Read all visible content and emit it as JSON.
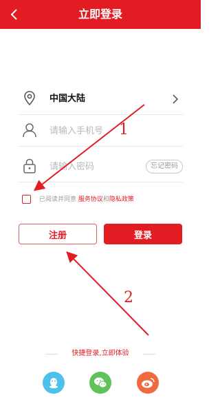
{
  "header": {
    "title": "立即登录",
    "back_icon": "chevron-left-icon",
    "color": "#e31b23"
  },
  "region": {
    "label": "中国大陆",
    "icon": "location-pin-icon"
  },
  "phone": {
    "placeholder": "请输入手机号",
    "value": "",
    "icon": "user-icon"
  },
  "password": {
    "placeholder": "请输入密码",
    "value": "",
    "icon": "lock-icon",
    "forgot_label": "忘记密码"
  },
  "agreement": {
    "checked": false,
    "prefix": "已阅读并同意 ",
    "service_link": "服务协议",
    "middle": "和",
    "privacy_link": "隐私政策"
  },
  "buttons": {
    "register": "注册",
    "login": "登录"
  },
  "quick_login": {
    "text": "快捷登录,立即体验",
    "providers": [
      "qq-icon",
      "wechat-icon",
      "weibo-icon"
    ]
  },
  "annotations": {
    "marker1": "1",
    "marker2": "2"
  }
}
